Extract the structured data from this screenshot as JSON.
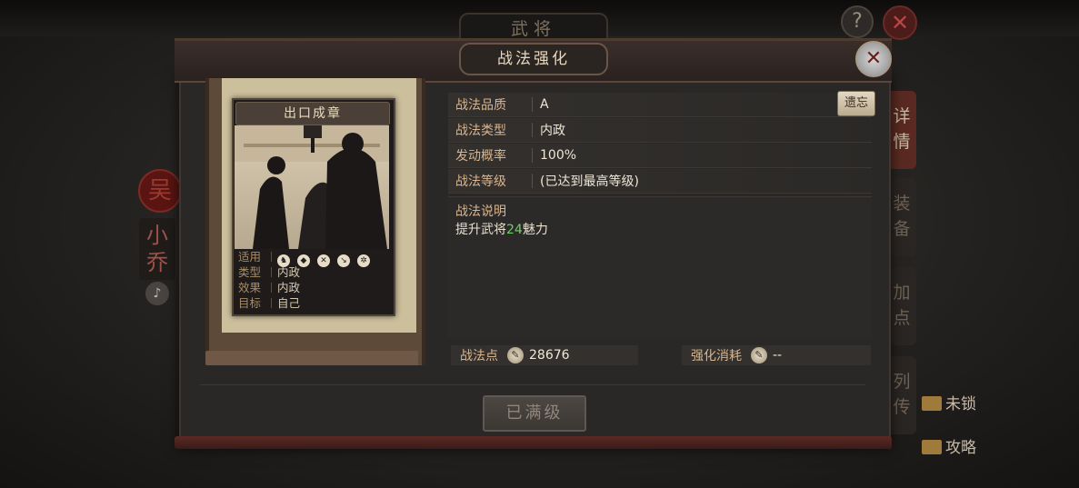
{
  "header": {
    "back_title": "武将",
    "help": "?",
    "close_back": "✕"
  },
  "hero": {
    "seal": "吴",
    "name": "小乔"
  },
  "right_tabs": [
    "详情",
    "装备",
    "加点",
    "列传"
  ],
  "side_links": {
    "unlock": "未锁",
    "guide": "攻略"
  },
  "dialog": {
    "title": "战法强化",
    "close": "✕",
    "card": {
      "title": "出口成章",
      "rows": [
        {
          "key": "适用",
          "value": ""
        },
        {
          "key": "类型",
          "value": "内政"
        },
        {
          "key": "效果",
          "value": "内政"
        },
        {
          "key": "目标",
          "value": "自己"
        }
      ],
      "troop_icons": [
        "cavalry-icon",
        "shield-icon",
        "archer-icon",
        "spear-icon",
        "siege-icon"
      ]
    },
    "info": [
      {
        "key": "战法品质",
        "value": "A"
      },
      {
        "key": "战法类型",
        "value": "内政"
      },
      {
        "key": "发动概率",
        "value": "100%"
      },
      {
        "key": "战法等级",
        "value": "(已达到最高等级)"
      }
    ],
    "choose_button": "遗忘",
    "desc_label": "战法说明",
    "desc_prefix": "提升武将",
    "desc_highlight": "24",
    "desc_suffix": "魅力",
    "points_label": "战法点",
    "points_value": "28676",
    "cost_label": "强化消耗",
    "cost_value": "--",
    "max_button": "已满级"
  },
  "colors": {
    "highlight": "#6fd069",
    "label": "#d8b58f",
    "panel": "#2a2826"
  }
}
